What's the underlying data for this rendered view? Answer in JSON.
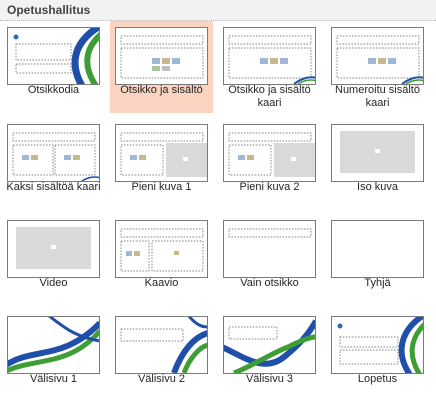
{
  "gallery": {
    "title": "Opetushallitus",
    "layouts": [
      {
        "label": "Otsikkodia",
        "selected": false
      },
      {
        "label": "Otsikko ja sisältö",
        "selected": true
      },
      {
        "label": "Otsikko ja sisältö kaari",
        "selected": false
      },
      {
        "label": "Numeroitu sisältö kaari",
        "selected": false
      },
      {
        "label": "Kaksi sisältöä kaari",
        "selected": false
      },
      {
        "label": "Pieni kuva 1",
        "selected": false
      },
      {
        "label": "Pieni kuva 2",
        "selected": false
      },
      {
        "label": "Iso kuva",
        "selected": false
      },
      {
        "label": "Video",
        "selected": false
      },
      {
        "label": "Kaavio",
        "selected": false
      },
      {
        "label": "Vain otsikko",
        "selected": false
      },
      {
        "label": "Tyhjä",
        "selected": false
      },
      {
        "label": "Välisivu 1",
        "selected": false
      },
      {
        "label": "Välisivu 2",
        "selected": false
      },
      {
        "label": "Välisivu 3",
        "selected": false
      },
      {
        "label": "Lopetus",
        "selected": false
      }
    ]
  },
  "colors": {
    "selected_background": "#fad4c0",
    "brand_blue": "#1f4fa8",
    "brand_green": "#3c9e35",
    "placeholder_gray": "#d9d9d9"
  }
}
